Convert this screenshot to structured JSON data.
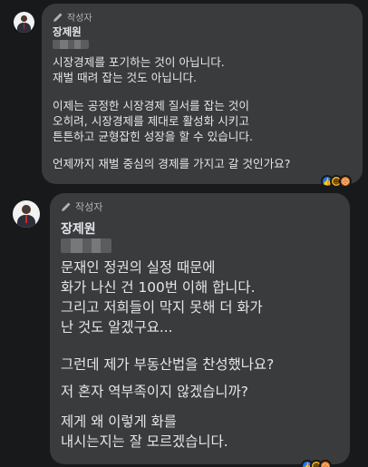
{
  "comments": [
    {
      "badge": "작성자",
      "author": "장제원",
      "paragraphs": [
        "시장경제를 포기하는 것이 아닙니다.\n재벌 때려 잡는 것도 아닙니다.",
        "이제는 공정한 시장경제 질서를 잡는 것이\n오히려, 시장경제를 제대로 활성화 시키고\n튼튼하고 균형잡힌 성장을 할 수 있습니다.",
        "언제까지 재벌 중심의 경제를 가지고 갈 것인가요?"
      ],
      "reactions": [
        "like-reaction-icon",
        "haha-reaction-icon",
        "angry-reaction-icon"
      ]
    },
    {
      "badge": "작성자",
      "author": "장제원",
      "paragraphs": [
        "문재인 정권의 실정 때문에\n화가 나신 건 100번 이해 합니다.\n그리고 저희들이 막지 못해 더 화가\n난 것도 알겠구요...",
        "그런데 제가 부동산법을 찬성했나요?",
        "저 혼자 역부족이지 않겠습니까?",
        "제게 왜 이렇게 화를\n내시는지는 잘 모르겠습니다."
      ],
      "reactions": [
        "like-reaction-icon",
        "haha-reaction-icon",
        "angry-reaction-icon"
      ]
    }
  ],
  "colors": {
    "background": "#18191a",
    "bubble": "#3a3b3c",
    "text": "#e4e6eb",
    "muted": "#b0b3b8"
  }
}
